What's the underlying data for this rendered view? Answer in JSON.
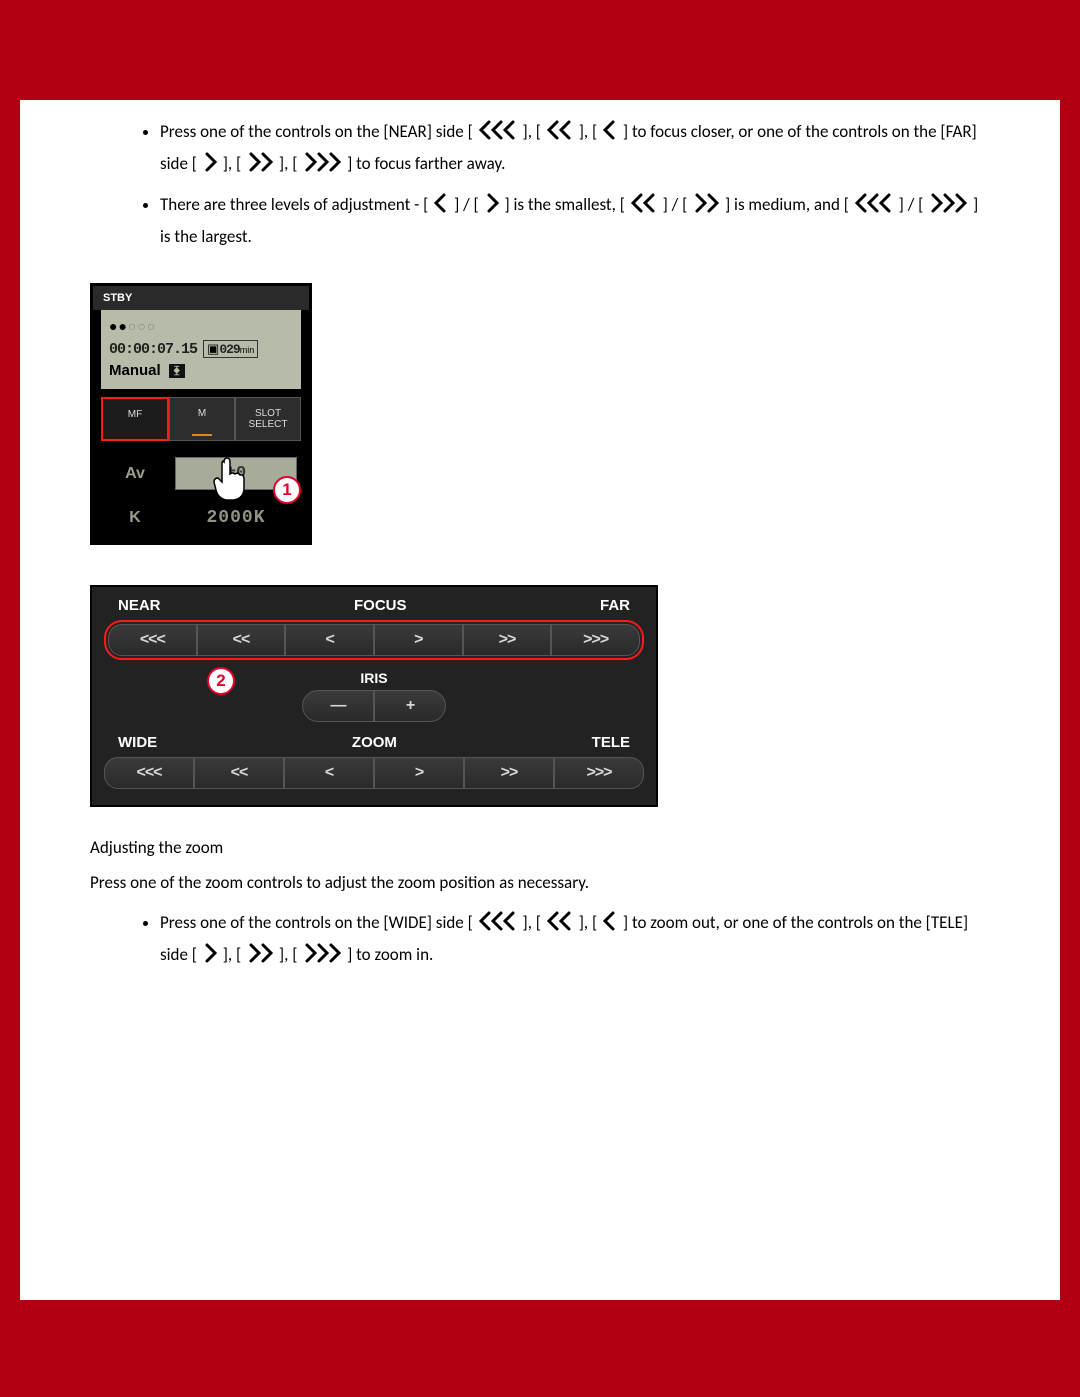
{
  "bullets_top": {
    "item1": {
      "t1": "Press one of the controls on the [NEAR] side [",
      "t2": "], [",
      "t3": "], [",
      "t4": "] to focus closer, or one of the controls on the [FAR] side [",
      "t5": "], [",
      "t6": "], [",
      "t7": "] to focus farther away."
    },
    "item2": {
      "t1": "There are three levels of adjustment - [",
      "t2": "] / [",
      "t3": "] is the smallest, [",
      "t4": "] / [",
      "t5": "] is medium, and [",
      "t6": "] / [",
      "t7": "] is the largest."
    }
  },
  "camera": {
    "stby": "STBY",
    "timecode": "00:00:07.15",
    "remaining": "029",
    "remaining_unit": "min",
    "manual": "Manual",
    "btn_mf": "MF",
    "btn_m": "M",
    "btn_slot": "SLOT SELECT",
    "av_label": "Av",
    "av_value": "±0",
    "k_label": "K",
    "k_value": "2000K",
    "callout1": "1"
  },
  "panel": {
    "focus_near": "NEAR",
    "focus_mid": "FOCUS",
    "focus_far": "FAR",
    "iris": "IRIS",
    "zoom_wide": "WIDE",
    "zoom_mid": "ZOOM",
    "zoom_tele": "TELE",
    "b_lll": "<<<",
    "b_ll": "<<",
    "b_l": "<",
    "b_r": ">",
    "b_rr": ">>",
    "b_rrr": ">>>",
    "iris_minus": "—",
    "iris_plus": "+",
    "callout2": "2"
  },
  "zoom_section": {
    "heading": "Adjusting the zoom",
    "intro": "Press one of the zoom controls to adjust the zoom position as necessary."
  },
  "bullets_bottom": {
    "item1": {
      "t1": "Press one of the controls on the [WIDE] side [",
      "t2": "], [",
      "t3": "], [",
      "t4": "] to zoom out, or one of the controls on the [TELE] side [",
      "t5": "], [",
      "t6": "], [",
      "t7": "] to zoom in."
    }
  }
}
